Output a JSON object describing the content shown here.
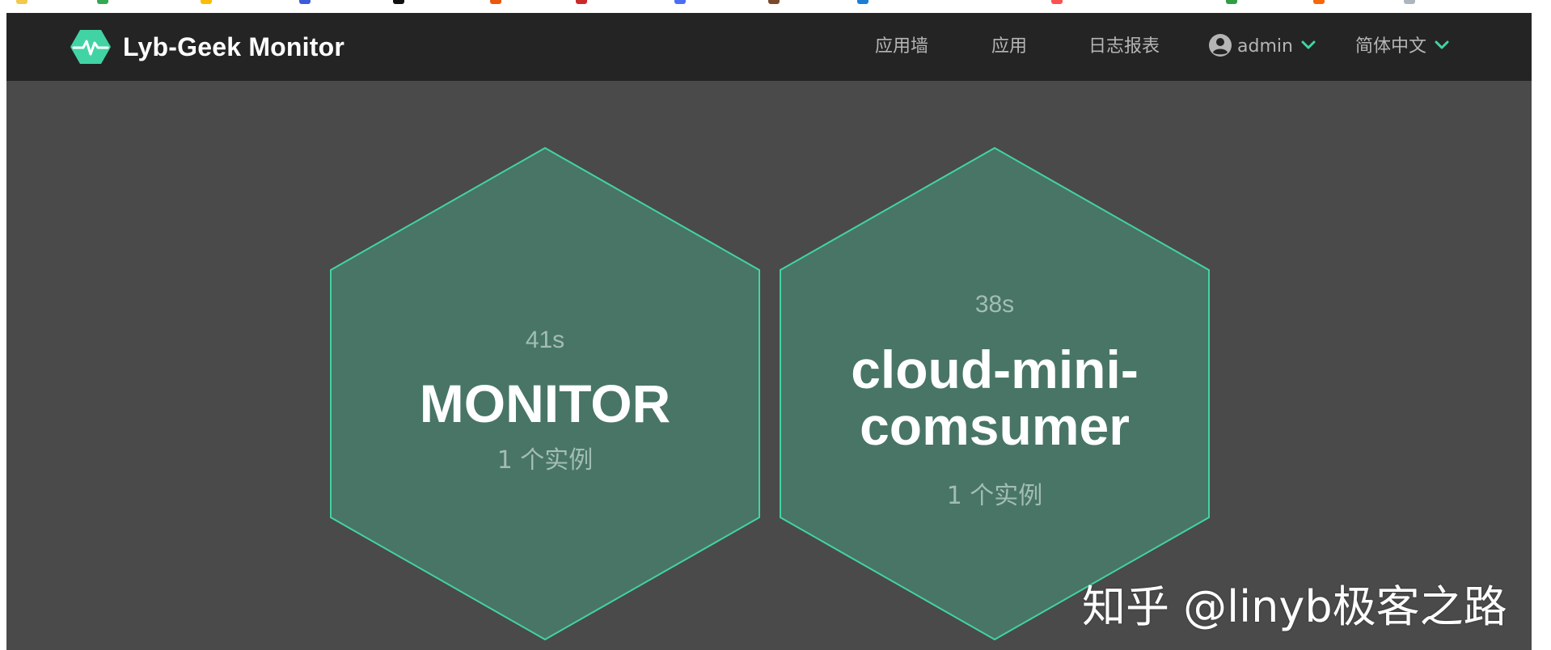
{
  "app": {
    "brand_title": "Lyb-Geek Monitor",
    "logo_icon": "heartbeat-hexagon-icon",
    "accent_color": "#42d3a5",
    "navbar_bg": "#242424",
    "content_bg": "#4a4a4a"
  },
  "nav": {
    "items": [
      {
        "label": "应用墙"
      },
      {
        "label": "应用"
      },
      {
        "label": "日志报表"
      }
    ],
    "user": {
      "label": "admin",
      "icon": "user-circle-icon"
    },
    "language": {
      "label": "简体中文"
    }
  },
  "applications": [
    {
      "name_lines": [
        "MONITOR"
      ],
      "last_update": "41s",
      "instances": "1 个实例",
      "status_color": "#487566"
    },
    {
      "name_lines": [
        "cloud-mini-",
        "comsumer"
      ],
      "last_update": "38s",
      "instances": "1 个实例",
      "status_color": "#487566"
    }
  ],
  "watermark": "知乎 @linyb极客之路"
}
